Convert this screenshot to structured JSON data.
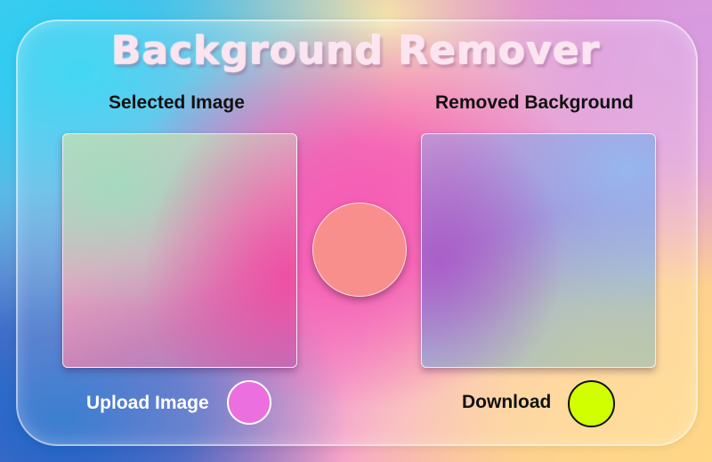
{
  "app": {
    "title": "Background Remover"
  },
  "panels": {
    "selected_label": "Selected Image",
    "removed_label": "Removed Background"
  },
  "actions": {
    "upload_label": "Upload Image",
    "download_label": "Download"
  },
  "colors": {
    "process_circle": "#f88f8d",
    "upload_button": "#ec6fe0",
    "download_button": "#d1ff00"
  }
}
